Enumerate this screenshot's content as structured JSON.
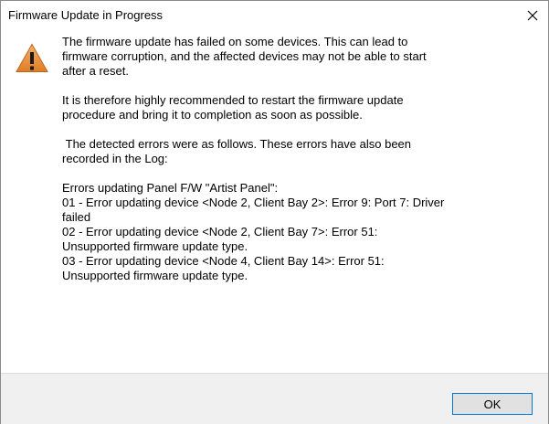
{
  "window": {
    "title": "Firmware Update in Progress",
    "close_icon": "close-icon"
  },
  "message": {
    "icon": "warning-triangle-icon",
    "paragraph1": "The firmware update has failed on some devices. This can lead to\nfirmware corruption, and the affected devices may not be able to start\nafter a reset.",
    "paragraph2": "It is therefore highly recommended to restart the firmware update\nprocedure and bring it to completion as soon as possible.",
    "paragraph3": " The detected errors were as follows. These errors have also been\nrecorded in the Log:",
    "errors_heading": "Errors updating Panel F/W \"Artist Panel\":",
    "errors": [
      "01 - Error updating device <Node 2, Client Bay 2>: Error 9: Port 7: Driver\nfailed",
      "02 - Error updating device <Node 2, Client Bay 7>: Error 51:\nUnsupported firmware update type.",
      "03 - Error updating device <Node 4, Client Bay 14>: Error 51:\nUnsupported firmware update type."
    ]
  },
  "footer": {
    "ok_label": "OK"
  },
  "colors": {
    "accent_border": "#0078d7",
    "footer_bg": "#f0f0f0",
    "warning_fill": "#e8903a"
  }
}
